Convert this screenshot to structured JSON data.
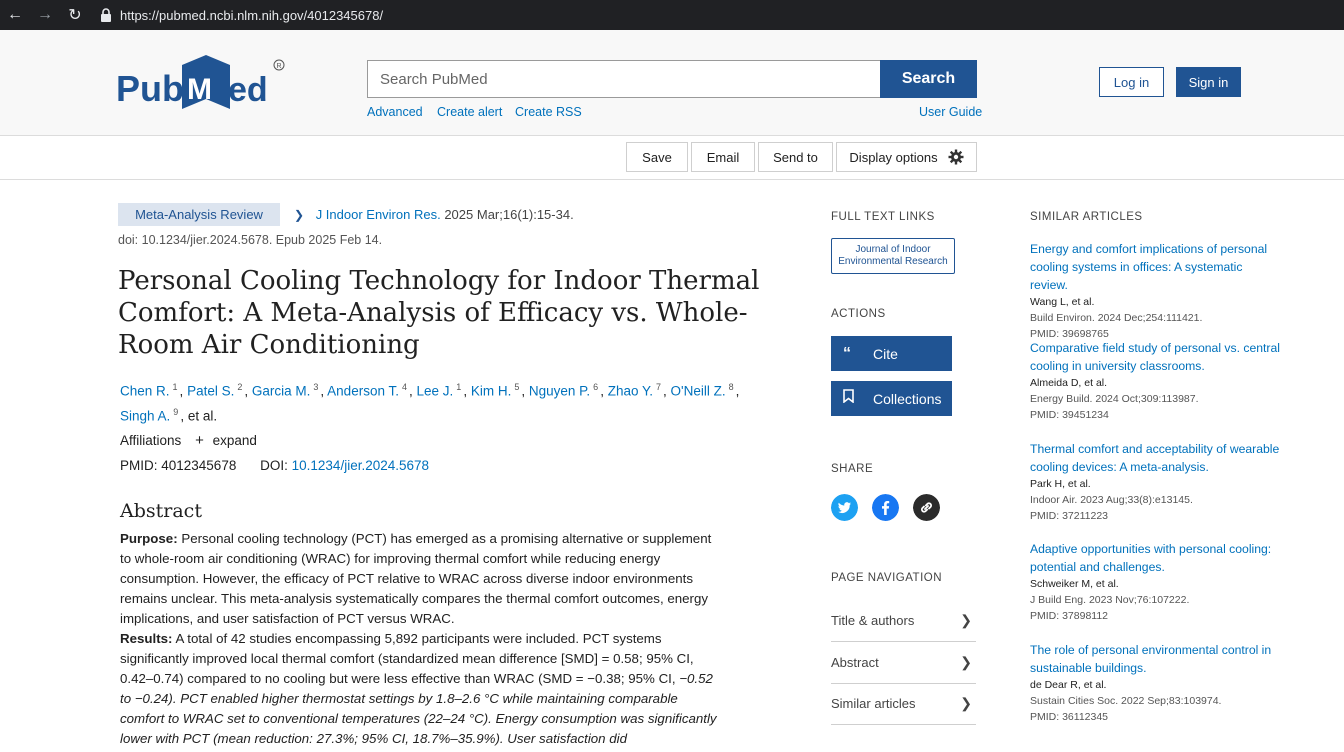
{
  "browser": {
    "url": "https://pubmed.ncbi.nlm.nih.gov/4012345678/"
  },
  "header": {
    "logo_text": "PubMed",
    "search_placeholder": "Search PubMed",
    "search_button": "Search",
    "links": {
      "advanced": "Advanced",
      "create_alert": "Create alert",
      "create_rss": "Create RSS",
      "user_guide": "User Guide"
    },
    "login": "Log in",
    "signin": "Sign in"
  },
  "toolbar": {
    "save": "Save",
    "email": "Email",
    "send_to": "Send to",
    "display_options": "Display options"
  },
  "article": {
    "type": "Meta-Analysis Review",
    "journal": "J Indoor Environ Res.",
    "citation": "2025 Mar;16(1):15-34.",
    "doi_line": "doi: 10.1234/jier.2024.5678. Epub 2025 Feb 14.",
    "title": "Personal Cooling Technology for Indoor Thermal Comfort: A Meta-Analysis of Efficacy vs. Whole-Room Air Conditioning",
    "authors": [
      {
        "name": "Chen R.",
        "sup": "1"
      },
      {
        "name": "Patel S.",
        "sup": "2"
      },
      {
        "name": "Garcia M.",
        "sup": "3"
      },
      {
        "name": "Anderson T.",
        "sup": "4"
      },
      {
        "name": "Lee J.",
        "sup": "1"
      },
      {
        "name": "Kim H.",
        "sup": "5"
      },
      {
        "name": "Nguyen P.",
        "sup": "6"
      },
      {
        "name": "Zhao Y.",
        "sup": "7"
      },
      {
        "name": "O'Neill Z.",
        "sup": "8"
      },
      {
        "name": "Singh A.",
        "sup": "9"
      }
    ],
    "et_al": ", et al.",
    "affiliations_label": "Affiliations",
    "expand_label": "expand",
    "pmid_label": "PMID: 4012345678",
    "doi_label": "DOI:",
    "doi_value": "10.1234/jier.2024.5678",
    "abstract_heading": "Abstract",
    "purpose_label": "Purpose:",
    "purpose_text": "Personal cooling technology (PCT) has emerged as a promising alternative or supplement to whole-room air conditioning (WRAC) for improving thermal comfort while reducing energy consumption. However, the efficacy of PCT relative to WRAC across diverse indoor environments remains unclear. This meta-analysis systematically compares the thermal comfort outcomes, energy implications, and user satisfaction of PCT versus WRAC.",
    "results_label": "Results:",
    "results_text_1": "A total of 42 studies encompassing 5,892 participants were included. PCT systems significantly improved local thermal comfort (standardized mean difference [SMD] = 0.58; 95% CI, 0.42–0.74) compared to no cooling but were less effective than WRAC (SMD = −0.38; 95% CI,",
    "results_text_2": "−0.52 to −0.24). PCT enabled higher thermostat settings by 1.8–2.6 °C while maintaining comparable comfort to WRAC set to conventional temperatures (22–24 °C). Energy consumption was significantly lower with PCT (mean reduction: 27.3%; 95% CI, 18.7%–35.9%). User satisfaction did"
  },
  "sidebar": {
    "full_text_heading": "FULL TEXT LINKS",
    "full_text_link": "Journal of Indoor Environmental Research",
    "actions_heading": "ACTIONS",
    "cite": "Cite",
    "collections": "Collections",
    "share_heading": "SHARE",
    "page_nav_heading": "PAGE NAVIGATION",
    "page_nav": [
      "Title & authors",
      "Abstract",
      "Similar articles"
    ]
  },
  "similar": {
    "heading": "SIMILAR ARTICLES",
    "items": [
      {
        "title": "Energy and comfort implications of personal cooling systems in offices: A systematic review.",
        "authors": "Wang L, et al.",
        "journal": "Build Environ. 2024 Dec;254:111421.",
        "pmid": "PMID: 39698765"
      },
      {
        "title": "Comparative field study of personal vs. central cooling in university classrooms.",
        "authors": "Almeida D, et al.",
        "journal": "Energy Build. 2024 Oct;309:113987.",
        "pmid": "PMID: 39451234"
      },
      {
        "title": "Thermal comfort and acceptability of wearable cooling devices: A meta-analysis.",
        "authors": "Park H, et al.",
        "journal": "Indoor Air. 2023 Aug;33(8):e13145.",
        "pmid": "PMID: 37211223"
      },
      {
        "title": "Adaptive opportunities with personal cooling: potential and challenges.",
        "authors": "Schweiker M, et al.",
        "journal": "J Build Eng. 2023 Nov;76:107222.",
        "pmid": "PMID: 37898112"
      },
      {
        "title": "The role of personal environmental control in sustainable buildings.",
        "authors": "de Dear R, et al.",
        "journal": "Sustain Cities Soc. 2022 Sep;83:103974.",
        "pmid": "PMID: 36112345"
      }
    ]
  },
  "colors": {
    "brand_blue": "#205493",
    "link_blue": "#0071bc",
    "badge_bg": "#dce4ef",
    "twitter": "#1da1f2",
    "facebook": "#1877f2",
    "link_share": "#2b2b2b"
  }
}
